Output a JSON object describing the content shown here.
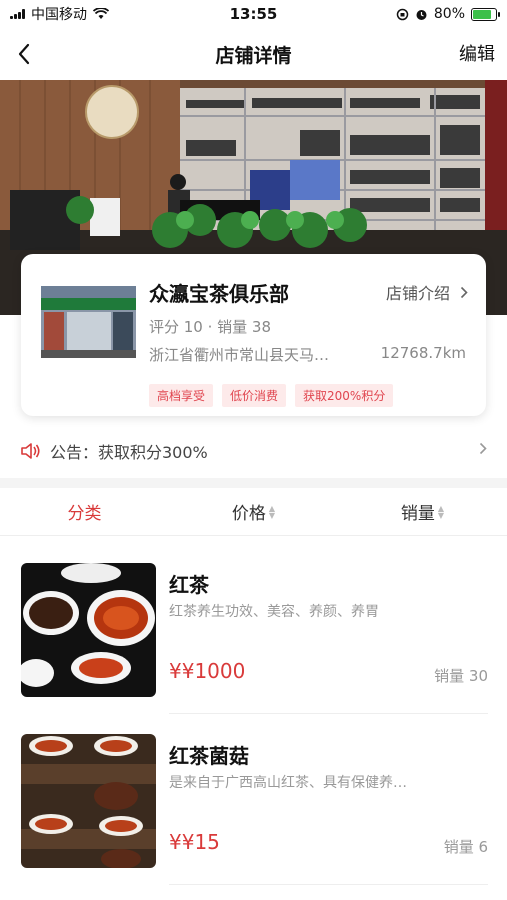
{
  "status_bar": {
    "carrier": "中国移动",
    "time": "13:55",
    "battery_text": "80%",
    "battery_level": 0.8,
    "battery_color": "#3cc04a"
  },
  "nav": {
    "title": "店铺详情",
    "edit_label": "编辑"
  },
  "store": {
    "name": "众瀛宝茶俱乐部",
    "intro_label": "店铺介绍",
    "rating_sales": "评分 10 · 销量 38",
    "address": "浙江省衢州市常山县天马…",
    "distance": "12768.7km",
    "tags": [
      "高档享受",
      "低价消费",
      "获取200%积分"
    ],
    "thumb_sign_text": "众瀛宝VIP茶文化"
  },
  "notice": {
    "text": "公告：获取积分300%"
  },
  "sort_bar": {
    "category": "分类",
    "price": "价格",
    "sales": "销量"
  },
  "products": [
    {
      "name": "红茶",
      "desc": "红茶养生功效、美容、养颜、养胃",
      "price": "¥¥1000",
      "sales": "销量 30"
    },
    {
      "name": "红茶菌菇",
      "desc": "是来自于广西高山红茶、具有保健养…",
      "price": "¥¥15",
      "sales": "销量 6"
    }
  ],
  "colors": {
    "accent_red": "#d93a3a",
    "tag_text": "#e0454f",
    "tag_bg": "#fdeaea"
  }
}
